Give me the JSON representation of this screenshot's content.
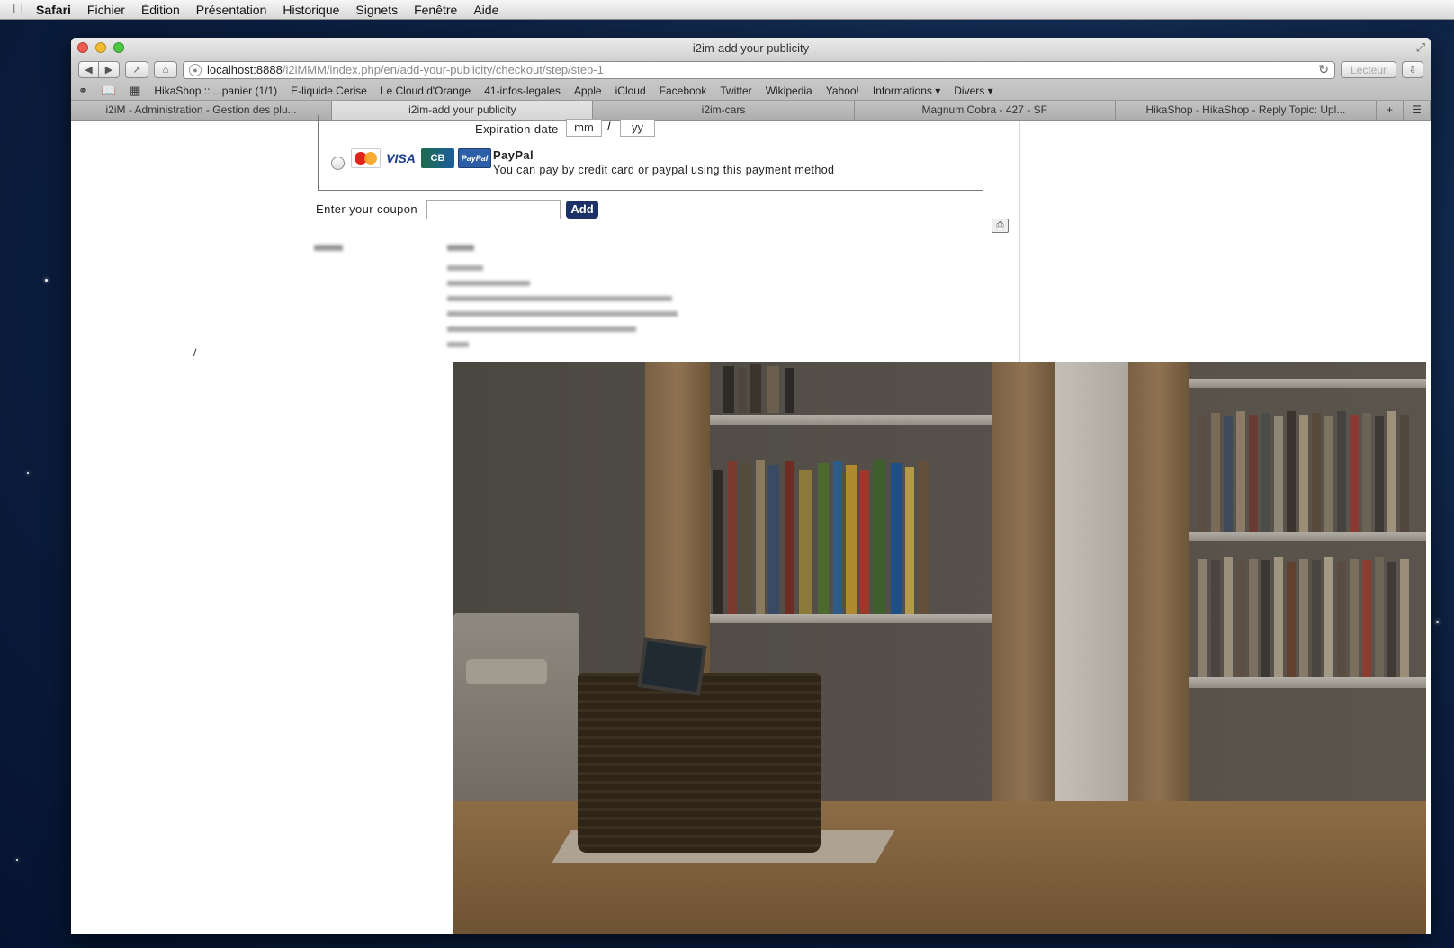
{
  "menubar": {
    "app": "Safari",
    "items": [
      "Fichier",
      "Édition",
      "Présentation",
      "Historique",
      "Signets",
      "Fenêtre",
      "Aide"
    ]
  },
  "window": {
    "title": "i2im-add your publicity"
  },
  "toolbar": {
    "url_host": "localhost:8888",
    "url_path": "/i2iMMM/index.php/en/add-your-publicity/checkout/step/step-1",
    "reader_label": "Lecteur"
  },
  "bookmarks": [
    "HikaShop :: ...panier (1/1)",
    "E-liquide Cerise",
    "Le Cloud d'Orange",
    "41-infos-legales",
    "Apple",
    "iCloud",
    "Facebook",
    "Twitter",
    "Wikipedia",
    "Yahoo!",
    "Informations ▾",
    "Divers ▾"
  ],
  "tabs": [
    {
      "label": "i2iM - Administration - Gestion des plu...",
      "active": false
    },
    {
      "label": "i2im-add your publicity",
      "active": true
    },
    {
      "label": "i2im-cars",
      "active": false
    },
    {
      "label": "Magnum Cobra - 427 - SF",
      "active": false
    },
    {
      "label": "HikaShop - HikaShop - Reply Topic: Upl...",
      "active": false
    }
  ],
  "payment": {
    "expiration_label": "Expiration date",
    "mm_placeholder": "mm",
    "yy_placeholder": "yy",
    "separator": "/",
    "paypal_title": "PayPal",
    "paypal_desc": "You can pay by credit card or paypal using this payment method",
    "cards": [
      "MasterCard",
      "VISA",
      "CB",
      "PayPal"
    ]
  },
  "coupon": {
    "label": "Enter your coupon",
    "button": "Add"
  },
  "misc": {
    "slash": "/"
  }
}
